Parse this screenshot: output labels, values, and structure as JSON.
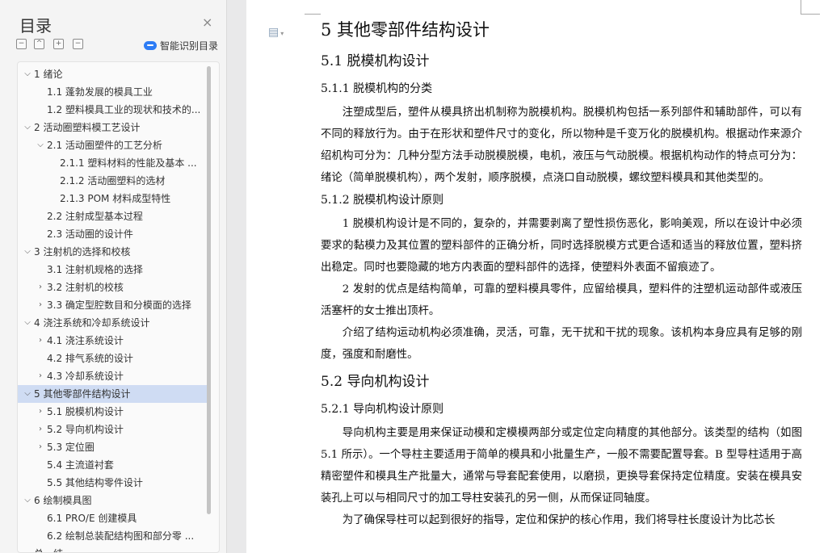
{
  "toc": {
    "title": "目录",
    "close_icon": "×",
    "toolbar": {
      "collapse_icon": "−",
      "up_icon": "^",
      "expand_icon": "+",
      "minus_icon": "−"
    },
    "smart_label": "智能识别目录",
    "items": [
      {
        "level": 1,
        "arrow": "⌵",
        "label": "1 绪论"
      },
      {
        "level": 2,
        "arrow": "",
        "label": "1.1 蓬勃发展的模具工业"
      },
      {
        "level": 2,
        "arrow": "",
        "label": "1.2 塑料模具工业的现状和技术的..."
      },
      {
        "level": 1,
        "arrow": "⌵",
        "label": "2 活动圈塑料模工艺设计"
      },
      {
        "level": 2,
        "arrow": "⌵",
        "label": "2.1 活动圈塑件的工艺分析"
      },
      {
        "level": 3,
        "arrow": "",
        "label": "2.1.1 塑料材料的性能及基本 ..."
      },
      {
        "level": 3,
        "arrow": "",
        "label": "2.1.2 活动圈塑料的选材"
      },
      {
        "level": 3,
        "arrow": "",
        "label": "2.1.3 POM 材料成型特性"
      },
      {
        "level": 2,
        "arrow": "",
        "label": "2.2 注射成型基本过程"
      },
      {
        "level": 2,
        "arrow": "",
        "label": "2.3 活动圈的设计件"
      },
      {
        "level": 1,
        "arrow": "⌵",
        "label": "3 注射机的选择和校核"
      },
      {
        "level": 2,
        "arrow": "",
        "label": "3.1 注射机规格的选择"
      },
      {
        "level": 2,
        "arrow": "›",
        "label": "3.2 注射机的校核"
      },
      {
        "level": 2,
        "arrow": "›",
        "label": "3.3 确定型腔数目和分模面的选择"
      },
      {
        "level": 1,
        "arrow": "⌵",
        "label": "4 浇注系统和冷却系统设计"
      },
      {
        "level": 2,
        "arrow": "›",
        "label": "4.1 浇注系统设计"
      },
      {
        "level": 2,
        "arrow": "",
        "label": "4.2 排气系统的设计"
      },
      {
        "level": 2,
        "arrow": "›",
        "label": "4.3 冷却系统设计"
      },
      {
        "level": 1,
        "arrow": "⌵",
        "label": "5 其他零部件结构设计",
        "selected": true
      },
      {
        "level": 2,
        "arrow": "›",
        "label": "5.1 脱模机构设计"
      },
      {
        "level": 2,
        "arrow": "›",
        "label": "5.2 导向机构设计"
      },
      {
        "level": 2,
        "arrow": "›",
        "label": "5.3 定位圈"
      },
      {
        "level": 2,
        "arrow": "",
        "label": "5.4 主流道衬套"
      },
      {
        "level": 2,
        "arrow": "",
        "label": "5.5 其他结构零件设计"
      },
      {
        "level": 1,
        "arrow": "⌵",
        "label": "6 绘制模具图"
      },
      {
        "level": 2,
        "arrow": "",
        "label": "6.1 PRO/E 创建模具"
      },
      {
        "level": 2,
        "arrow": "",
        "label": "6.2 绘制总装配结构图和部分零 ..."
      },
      {
        "level": 1,
        "arrow": "",
        "label": "总　结"
      }
    ]
  },
  "doc": {
    "icon": "▤",
    "blocks": [
      {
        "type": "h1",
        "text": "5 其他零部件结构设计"
      },
      {
        "type": "h2",
        "text": "5.1 脱模机构设计"
      },
      {
        "type": "h3",
        "text": "5.1.1 脱模机构的分类"
      },
      {
        "type": "p",
        "text": "注塑成型后，塑件从模具挤出机制称为脱模机构。脱模机构包括一系列部件和辅助部件，可以有不同的释放行为。由于在形状和塑件尺寸的变化，所以物种是千变万化的脱模机构。根据动作来源介绍机构可分为：几种分型方法手动脱模脱模，电机，液压与气动脱模。根据机构动作的特点可分为：绪论（简单脱模机构），两个发射，顺序脱模，点浇口自动脱模，螺纹塑料模具和其他类型的。"
      },
      {
        "type": "h3",
        "text": "5.1.2 脱模机构设计原则"
      },
      {
        "type": "p",
        "text": "1 脱模机构设计是不同的，复杂的，并需要剥离了塑性损伤恶化，影响美观，所以在设计中必须要求的黏模力及其位置的塑料部件的正确分析，同时选择脱模方式更合适和适当的释放位置，塑料挤出稳定。同时也要隐藏的地方内表面的塑料部件的选择，使塑料外表面不留痕迹了。"
      },
      {
        "type": "p",
        "text": "2 发射的优点是结构简单，可靠的塑料模具零件，应留给模具，塑料件的注塑机运动部件或液压活塞杆的女士推出顶杆。"
      },
      {
        "type": "p",
        "text": "介绍了结构运动机构必须准确，灵活，可靠，无干扰和干扰的现象。该机构本身应具有足够的刚度，强度和耐磨性。"
      },
      {
        "type": "h2",
        "text": "5.2 导向机构设计"
      },
      {
        "type": "h3",
        "text": "5.2.1 导向机构设计原则"
      },
      {
        "type": "p",
        "text": "导向机构主要是用来保证动模和定模模两部分或定位定向精度的其他部分。该类型的结构（如图 5.1 所示）。一个导柱主要适用于简单的模具和小批量生产，一般不需要配置导套。B 型导柱适用于高精密塑件和模具生产批量大，通常与导套配套使用，以磨损，更换导套保持定位精度。安装在模具安装孔上可以与相同尺寸的加工导柱安装孔的另一侧，从而保证同轴度。"
      },
      {
        "type": "p",
        "text": "为了确保导柱可以起到很好的指导，定位和保护的核心作用，我们将导柱长度设计为比芯长"
      }
    ]
  }
}
